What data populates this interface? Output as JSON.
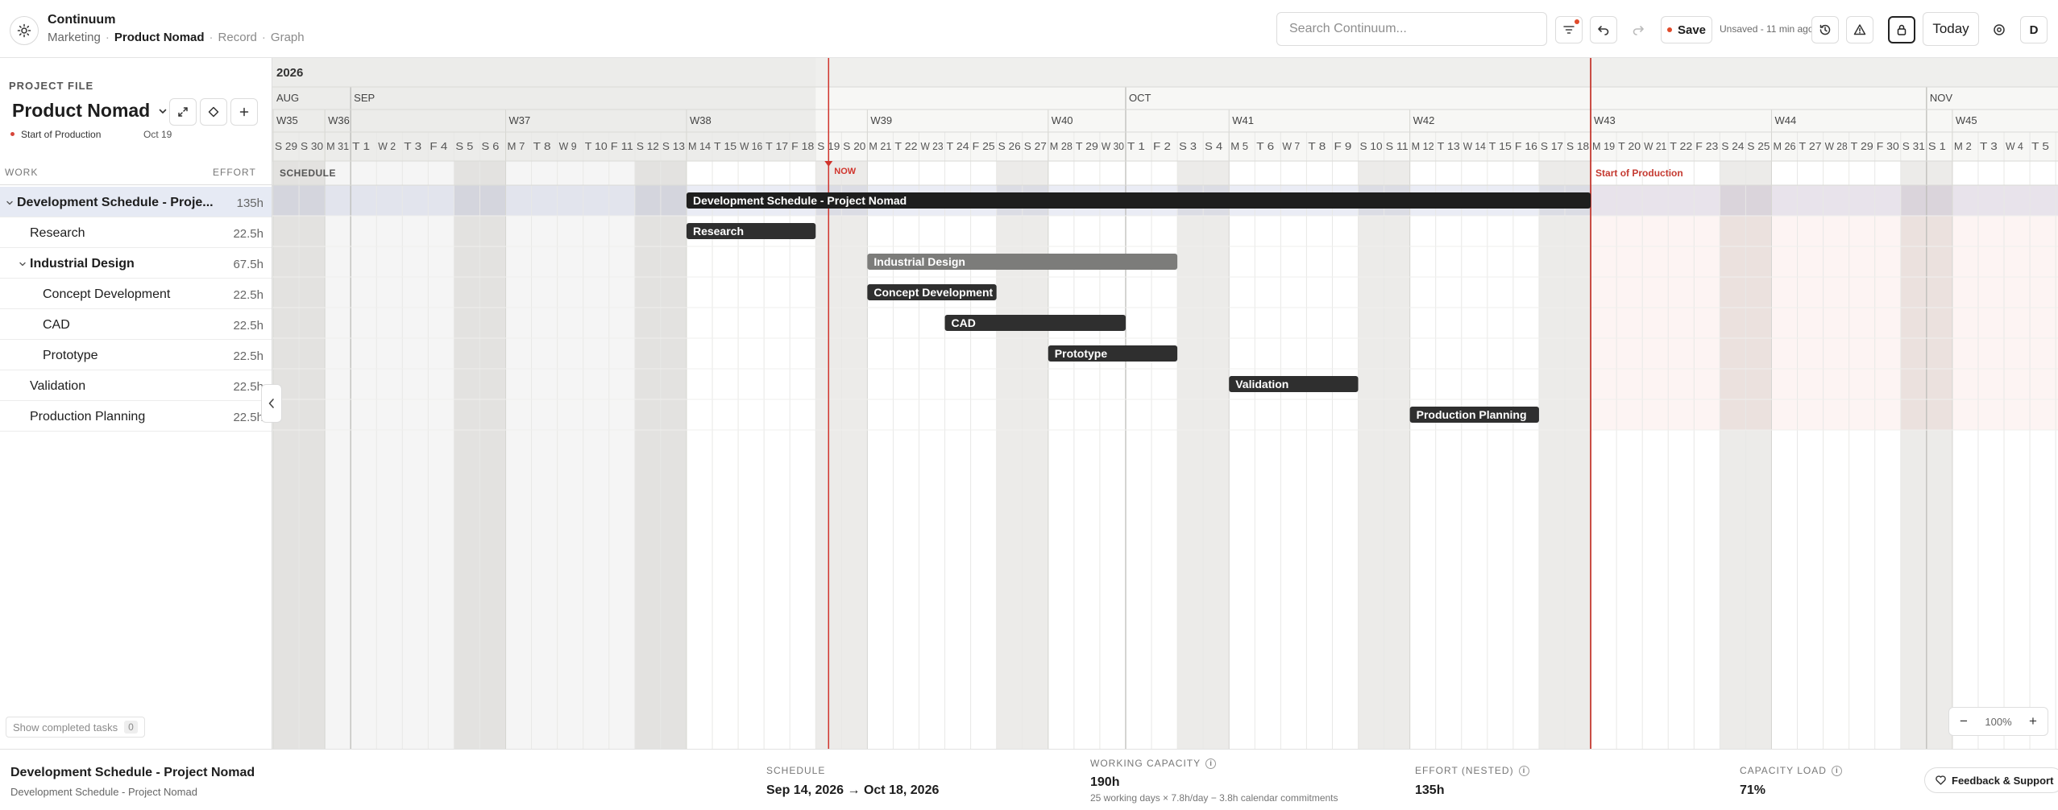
{
  "app": {
    "name": "Continuum"
  },
  "breadcrumb": {
    "section": "Marketing",
    "current": "Product Nomad",
    "record": "Record",
    "graph": "Graph"
  },
  "toolbar": {
    "search_placeholder": "Search Continuum...",
    "save_label": "Save",
    "unsaved_text": "Unsaved - 11 min ago",
    "today_label": "Today",
    "avatar_initial": "D"
  },
  "project": {
    "section_label": "PROJECT FILE",
    "title": "Product Nomad",
    "milestone": {
      "name": "Start of Production",
      "date": "Oct 19"
    }
  },
  "columns": {
    "work": "WORK",
    "effort": "EFFORT"
  },
  "tasks": [
    {
      "name": "Development Schedule - Proje...",
      "bar_label": "Development Schedule - Project Nomad",
      "effort": "135h",
      "level": 0,
      "bold": true,
      "expanded": true,
      "selected": true,
      "start": "2026-09-14",
      "end": "2026-10-18",
      "style": "summary"
    },
    {
      "name": "Research",
      "bar_label": "Research",
      "effort": "22.5h",
      "level": 1,
      "bold": false,
      "start": "2026-09-14",
      "end": "2026-09-18",
      "style": "dark"
    },
    {
      "name": "Industrial Design",
      "bar_label": "Industrial Design",
      "effort": "67.5h",
      "level": 1,
      "bold": true,
      "expanded": true,
      "start": "2026-09-21",
      "end": "2026-10-02",
      "style": "group"
    },
    {
      "name": "Concept Development",
      "bar_label": "Concept Development",
      "effort": "22.5h",
      "level": 2,
      "bold": false,
      "start": "2026-09-21",
      "end": "2026-09-25",
      "style": "dark"
    },
    {
      "name": "CAD",
      "bar_label": "CAD",
      "effort": "22.5h",
      "level": 2,
      "bold": false,
      "start": "2026-09-24",
      "end": "2026-09-30",
      "style": "dark"
    },
    {
      "name": "Prototype",
      "bar_label": "Prototype",
      "effort": "22.5h",
      "level": 2,
      "bold": false,
      "start": "2026-09-28",
      "end": "2026-10-02",
      "style": "dark"
    },
    {
      "name": "Validation",
      "bar_label": "Validation",
      "effort": "22.5h",
      "level": 1,
      "bold": false,
      "start": "2026-10-05",
      "end": "2026-10-09",
      "style": "dark"
    },
    {
      "name": "Production Planning",
      "bar_label": "Production Planning",
      "effort": "22.5h",
      "level": 1,
      "bold": false,
      "start": "2026-10-12",
      "end": "2026-10-16",
      "style": "dark"
    }
  ],
  "timeline": {
    "year_label": "2026",
    "range_start": "2026-08-29",
    "range_end": "2026-11-05",
    "months": [
      {
        "label": "AUG",
        "start": "2026-08-29"
      },
      {
        "label": "SEP",
        "start": "2026-09-01"
      },
      {
        "label": "OCT",
        "start": "2026-10-01"
      },
      {
        "label": "NOV",
        "start": "2026-11-01"
      }
    ],
    "weeks": [
      {
        "label": "W35",
        "start": "2026-08-29"
      },
      {
        "label": "W36",
        "start": "2026-08-31"
      },
      {
        "label": "W37",
        "start": "2026-09-07"
      },
      {
        "label": "W38",
        "start": "2026-09-14"
      },
      {
        "label": "W39",
        "start": "2026-09-21"
      },
      {
        "label": "W40",
        "start": "2026-09-28"
      },
      {
        "label": "W41",
        "start": "2026-10-05"
      },
      {
        "label": "W42",
        "start": "2026-10-12"
      },
      {
        "label": "W43",
        "start": "2026-10-19"
      },
      {
        "label": "W44",
        "start": "2026-10-26"
      },
      {
        "label": "W45",
        "start": "2026-11-02"
      }
    ],
    "schedule_label": "SCHEDULE",
    "now_label": "NOW",
    "now_date": "2026-09-19",
    "past_shade_start": "2026-09-14",
    "milestone_label": "Start of Production",
    "milestone_date": "2026-10-19",
    "zoom_level": "100%"
  },
  "footer": {
    "title": "Development Schedule - Project Nomad",
    "subtitle": "Development Schedule - Project Nomad",
    "schedule_label": "SCHEDULE",
    "schedule_value": "Sep 14, 2026 → Oct 18, 2026",
    "capacity_label": "WORKING CAPACITY",
    "capacity_value": "190h",
    "capacity_note": "25 working days × 7.8h/day − 3.8h calendar commitments",
    "effort_label": "EFFORT (NESTED)",
    "effort_value": "135h",
    "load_label": "CAPACITY LOAD",
    "load_value": "71%",
    "feedback_label": "Feedback & Support"
  },
  "show_completed": {
    "label": "Show completed tasks",
    "count": "0"
  },
  "colors": {
    "accent_red": "#d0342c",
    "bar_dark": "#2f2f2f",
    "bar_summary": "#1e1e1e",
    "bar_group": "#7c7c7a",
    "selected_row": "#e6eaf4",
    "weekend": "#eaeae8"
  }
}
